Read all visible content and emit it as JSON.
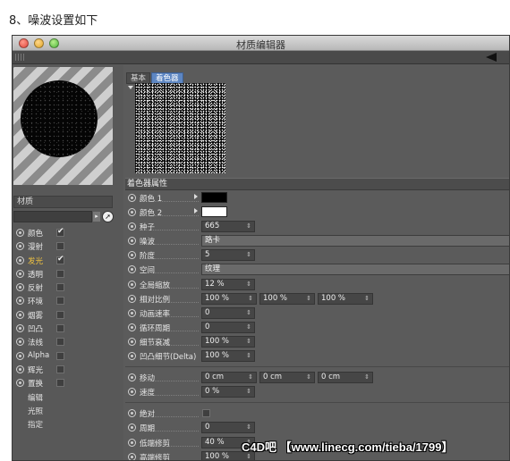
{
  "caption": "8、噪波设置如下",
  "window": {
    "title": "材质编辑器",
    "traffic_lights": [
      "close",
      "minimize",
      "maximize"
    ]
  },
  "material": {
    "name_label": "材质",
    "channels": [
      {
        "label": "颜色",
        "checked": true,
        "highlight": false
      },
      {
        "label": "漫射",
        "checked": false,
        "highlight": false
      },
      {
        "label": "发光",
        "checked": true,
        "highlight": true
      },
      {
        "label": "透明",
        "checked": false,
        "highlight": false
      },
      {
        "label": "反射",
        "checked": false,
        "highlight": false
      },
      {
        "label": "环境",
        "checked": false,
        "highlight": false
      },
      {
        "label": "烟雾",
        "checked": false,
        "highlight": false
      },
      {
        "label": "凹凸",
        "checked": false,
        "highlight": false
      },
      {
        "label": "法线",
        "checked": false,
        "highlight": false
      },
      {
        "label": "Alpha",
        "checked": false,
        "highlight": false
      },
      {
        "label": "辉光",
        "checked": false,
        "highlight": false
      },
      {
        "label": "置换",
        "checked": false,
        "highlight": false
      }
    ],
    "sub_items": [
      "编辑",
      "光照",
      "指定"
    ]
  },
  "shader": {
    "tabs": [
      {
        "label": "基本",
        "active": false
      },
      {
        "label": "着色器",
        "active": true
      }
    ],
    "section_title": "着色器属性",
    "color1": {
      "label": "颜色 1",
      "color": "#000000"
    },
    "color2": {
      "label": "颜色 2",
      "color": "#ffffff"
    },
    "seed": {
      "label": "种子",
      "value": "665"
    },
    "noise": {
      "label": "噪波",
      "value": "路卡"
    },
    "octaves": {
      "label": "阶度",
      "value": "5"
    },
    "space": {
      "label": "空间",
      "value": "纹理"
    },
    "global_scale": {
      "label": "全局缩放",
      "value": "12 %"
    },
    "relative_scale": {
      "label": "相对比例",
      "values": [
        "100 %",
        "100 %",
        "100 %"
      ]
    },
    "anim_speed": {
      "label": "动画速率",
      "value": "0"
    },
    "loop_period": {
      "label": "循环周期",
      "value": "0"
    },
    "detail_atten": {
      "label": "细节衰减",
      "value": "100 %"
    },
    "delta": {
      "label": "凹凸细节(Delta)",
      "value": "100 %"
    },
    "movement": {
      "label": "移动",
      "values": [
        "0 cm",
        "0 cm",
        "0 cm"
      ]
    },
    "speed": {
      "label": "速度",
      "value": "0 %"
    },
    "absolute": {
      "label": "绝对",
      "checked": false
    },
    "cycles": {
      "label": "周期",
      "value": "0"
    },
    "low_clip": {
      "label": "低端修剪",
      "value": "40 %"
    },
    "high_clip": {
      "label": "高端修剪",
      "value": "100 %"
    }
  },
  "watermark": "C4D吧 【www.linecg.com/tieba/1799】",
  "icons": {
    "back_arrow": "arrow-left-icon",
    "nav": "triangle-right-icon",
    "cursor": "pointer-icon"
  }
}
